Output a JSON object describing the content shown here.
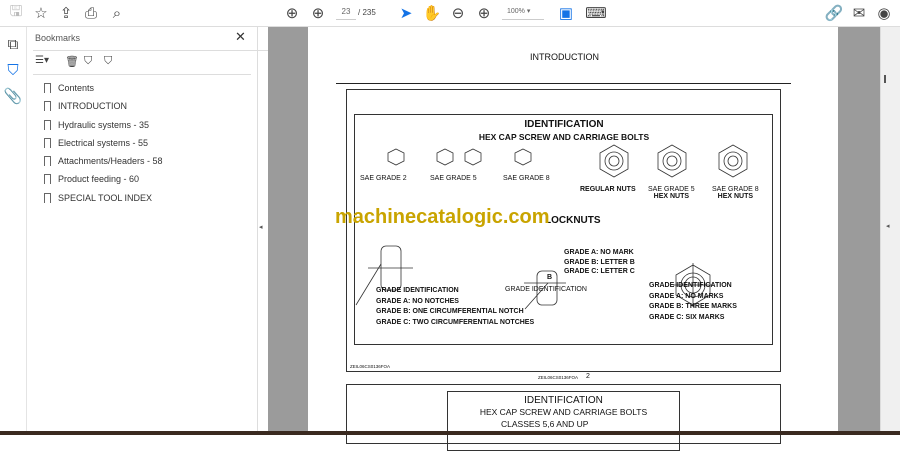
{
  "toolbar": {
    "page_current": "23",
    "page_total": "/ 235",
    "zoom": "100%"
  },
  "bookmarks": {
    "title": "Bookmarks",
    "items": [
      {
        "label": "Contents"
      },
      {
        "label": "INTRODUCTION"
      },
      {
        "label": "Hydraulic systems - 35"
      },
      {
        "label": "Electrical systems - 55"
      },
      {
        "label": "Attachments/Headers - 58"
      },
      {
        "label": "Product feeding - 60"
      },
      {
        "label": "SPECIAL TOOL INDEX"
      }
    ]
  },
  "document": {
    "header": "INTRODUCTION",
    "title": "IDENTIFICATION",
    "subtitle": "HEX CAP SCREW AND CARRIAGE BOLTS",
    "screws": [
      "SAE GRADE 2",
      "SAE GRADE 5",
      "SAE GRADE 8"
    ],
    "nuts": [
      {
        "l1": "REGULAR NUTS",
        "l2": ""
      },
      {
        "l1": "SAE GRADE 5",
        "l2": "HEX NUTS"
      },
      {
        "l1": "SAE GRADE 8",
        "l2": "HEX NUTS"
      }
    ],
    "locknuts": "LOCKNUTS",
    "watermark": "machinecatalogic.com",
    "left_grades": [
      "GRADE IDENTIFICATION",
      "GRADE A: NO NOTCHES",
      "GRADE B: ONE CIRCUMFERENTIAL NOTCH",
      "GRADE C: TWO CIRCUMFERENTIAL NOTCHES"
    ],
    "middle_label": "GRADE IDENTIFICATION",
    "middle_letter": "B",
    "middle_grades": [
      "GRADE A: NO MARK",
      "GRADE B: LETTER B",
      "GRADE C: LETTER C"
    ],
    "right_grades": [
      "GRADE IDENTIFICATION",
      "GRADE A: NO MARKS",
      "GRADE B: THREE MARKS",
      "GRADE C: SIX MARKS"
    ],
    "figure_code": "ZEIL06CS0136FOA",
    "footer_code": "ZEIL06CS0136FOA",
    "page_number": "2",
    "next_title": "IDENTIFICATION",
    "next_subtitle": "HEX CAP SCREW AND CARRIAGE BOLTS",
    "next_sub2": "CLASSES 5,6 AND UP"
  },
  "colors": {
    "accent": "#1473e6",
    "watermark": "#c9a400"
  }
}
